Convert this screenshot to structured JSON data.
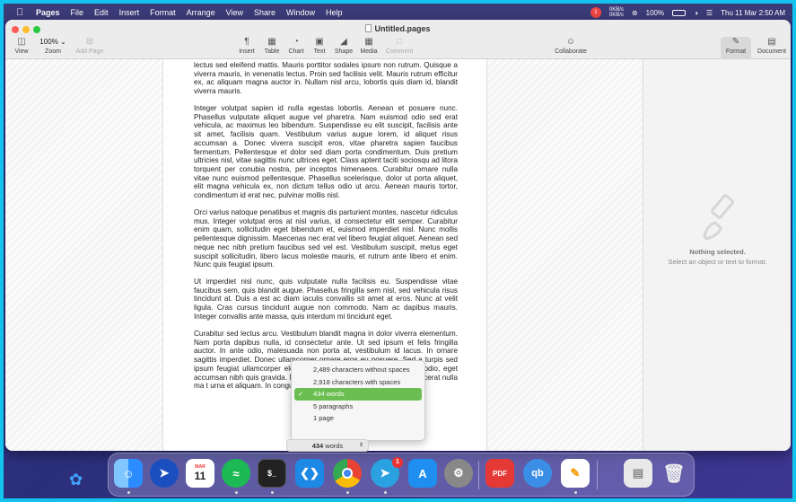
{
  "menubar": {
    "app_name": "Pages",
    "items": [
      "File",
      "Edit",
      "Insert",
      "Format",
      "Arrange",
      "View",
      "Share",
      "Window",
      "Help"
    ],
    "badge_count": "1",
    "net_speed_top": "0KB/s",
    "net_speed_bottom": "0KB/s",
    "battery": "100%",
    "clock": "Thu 11 Mar  2:50 AM"
  },
  "window": {
    "title": "Untitled.pages",
    "toolbar": {
      "view": "View",
      "zoom_value": "100%",
      "zoom": "Zoom",
      "add_page": "Add Page",
      "insert": "Insert",
      "table": "Table",
      "chart": "Chart",
      "text": "Text",
      "shape": "Shape",
      "media": "Media",
      "comment": "Comment",
      "collaborate": "Collaborate",
      "format": "Format",
      "document": "Document"
    }
  },
  "document": {
    "paragraphs": [
      "lectus sed eleifend mattis. Mauris porttitor sodales ipsum non rutrum. Quisque a viverra mauris, in venenatis lectus. Proin sed facilisis velit. Mauris rutrum efficitur ex, ac aliquam magna auctor in. Nullam nisl arcu, lobortis quis diam id, blandit viverra mauris.",
      "Integer volutpat sapien id nulla egestas lobortis. Aenean et posuere nunc. Phasellus vulputate aliquet augue vel pharetra. Nam euismod odio sed erat vehicula, ac maximus leo bibendum. Suspendisse eu elit suscipit, facilisis ante sit amet, facilisis quam. Vestibulum varius augue lorem, id aliquet risus accumsan a. Donec viverra suscipit eros, vitae pharetra sapien faucibus fermentum. Pellentesque et dolor sed diam porta condimentum. Duis pretium ultricies nisl, vitae sagittis nunc ultrices eget. Class aptent taciti sociosqu ad litora torquent per conubia nostra, per inceptos himenaeos. Curabitur ornare nulla vitae nunc euismod pellentesque. Phasellus scelerisque, dolor ut porta aliquet, elit magna vehicula ex, non dictum tellus odio ut arcu. Aenean mauris tortor, condimentum id erat nec, pulvinar mollis nisl.",
      "Orci varius natoque penatibus et magnis dis parturient montes, nascetur ridiculus mus. Integer volutpat eros at nisl varius, id consectetur elit semper. Curabitur enim quam, sollicitudin eget bibendum et, euismod imperdiet nisl. Nunc mollis pellentesque dignissim. Maecenas nec erat vel libero feugiat aliquet. Aenean sed neque nec nibh pretium faucibus sed vel est. Vestibulum suscipit, metus eget suscipit sollicitudin, libero lacus molestie mauris, et rutrum ante libero et enim. Nunc quis feugiat ipsum.",
      "Ut imperdiet nisl nunc, quis vulputate nulla facilisis eu. Suspendisse vitae faucibus sem, quis blandit augue. Phasellus fringilla sem nisl, sed vehicula risus tincidunt at. Duis a est ac diam iaculis convallis sit amet at eros. Nunc at velit ligula. Cras cursus tincidunt augue non commodo. Nam ac dapibus mauris. Integer convallis ante massa, quis interdum mi tincidunt eget.",
      "Curabitur sed lectus arcu. Vestibulum blandit magna in dolor viverra elementum. Nam porta dapibus nulla, id consectetur ante. Ut sed ipsum et felis fringilla auctor. In ante odio, malesuada non porta at, vestibulum id lacus. In ornare sagittis imperdiet. Donec ullamcorper ornare eros eu posuere. Sed a turpis sed ipsum feugiat ullamcorper elementum id enim. Nulla auctor feugiat odio, eget accumsan nibh quis gravida. Nunc imperdiet, do tincidunt lectus, id placerat nulla ma t urna et aliquam. In congue elit in feugiat eget."
    ]
  },
  "inspector": {
    "title": "Nothing selected.",
    "hint": "Select an object or text to format."
  },
  "word_count_menu": {
    "options": [
      "2,489 characters without spaces",
      "2,918 characters with spaces",
      "434 words",
      "5 paragraphs",
      "1 page"
    ],
    "selected_index": 2,
    "button_value": "434",
    "button_unit": "words"
  },
  "dock": {
    "calendar_month": "MAR",
    "calendar_day": "11",
    "telegram_badge": "1",
    "pdf_label": "PDF",
    "qb_label": "qb",
    "icons": [
      "finder-icon",
      "launchpad-icon",
      "calendar-icon",
      "spotify-icon",
      "terminal-icon",
      "vscode-icon",
      "chrome-icon",
      "telegram-icon",
      "app-store-icon",
      "system-preferences-icon",
      "pdf-expert-icon",
      "qbittorrent-icon",
      "pages-icon",
      "downloads-icon",
      "trash-icon"
    ]
  },
  "colors": {
    "border": "#12c3ee",
    "menubar": "#3b3b78",
    "selected_item": "#6bbf52",
    "spell_underline": "#d22"
  }
}
